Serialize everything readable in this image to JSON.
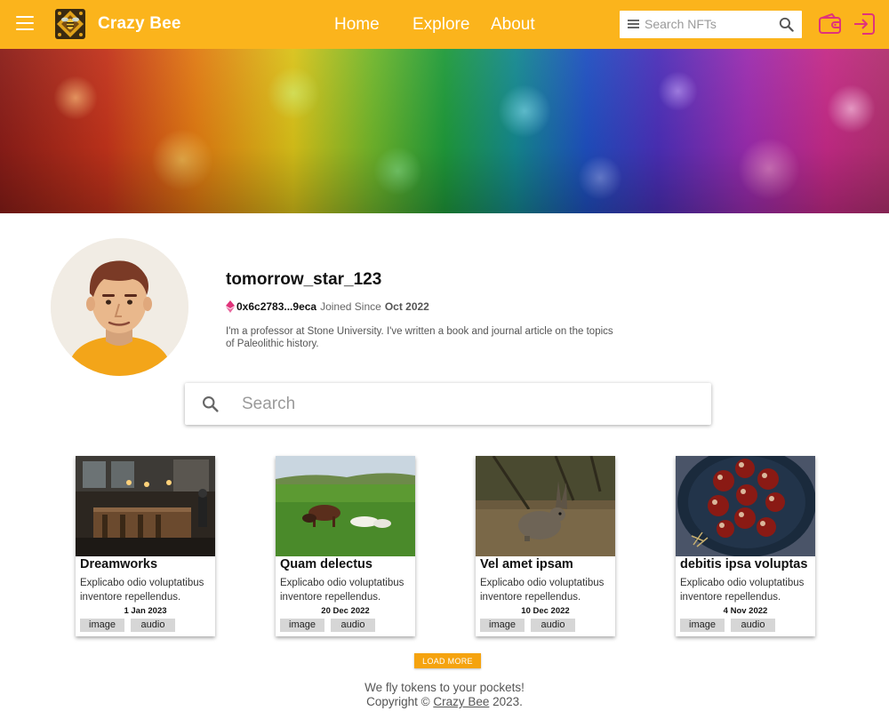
{
  "app": {
    "name": "Crazy Bee",
    "accent_color": "#fbb41c",
    "icon_color": "#e0337a"
  },
  "header": {
    "menu_icon": "hamburger-menu-icon",
    "logo_icon": "bee-logo-icon",
    "nav": [
      {
        "label": "Home"
      },
      {
        "label": "Explore"
      },
      {
        "label": "About"
      }
    ],
    "search": {
      "placeholder": "Search NFTs",
      "icon": "search-icon"
    },
    "wallet_icon": "wallet-icon",
    "login_icon": "login-icon"
  },
  "profile": {
    "username": "tomorrow_star_123",
    "address": "0x6c2783...9eca",
    "joined_label": "Joined Since",
    "joined_date": "Oct 2022",
    "bio": "I'm a professor at Stone University. I've written a book and journal article on the topics of Paleolithic history."
  },
  "search": {
    "placeholder": "Search",
    "icon": "search-icon"
  },
  "cards": [
    {
      "title": "Dreamworks",
      "description": "Explicabo odio voluptatibus inventore repellendus.",
      "date": "1 Jan 2023",
      "tags": [
        "image",
        "audio"
      ]
    },
    {
      "title": "Quam delectus",
      "description": "Explicabo odio voluptatibus inventore repellendus.",
      "date": "20 Dec 2022",
      "tags": [
        "image",
        "audio"
      ]
    },
    {
      "title": "Vel amet ipsam",
      "description": "Explicabo odio voluptatibus inventore repellendus.",
      "date": "10 Dec 2022",
      "tags": [
        "image",
        "audio"
      ]
    },
    {
      "title": "debitis ipsa voluptas",
      "description": "Explicabo odio voluptatibus inventore repellendus.",
      "date": "4 Nov 2022",
      "tags": [
        "image",
        "audio"
      ]
    }
  ],
  "load_more": "LOAD MORE",
  "footer": {
    "tagline": "We fly tokens to your pockets!",
    "copyright_prefix": "Copyright ©",
    "copyright_link": "Crazy Bee",
    "copyright_year": "2023."
  }
}
